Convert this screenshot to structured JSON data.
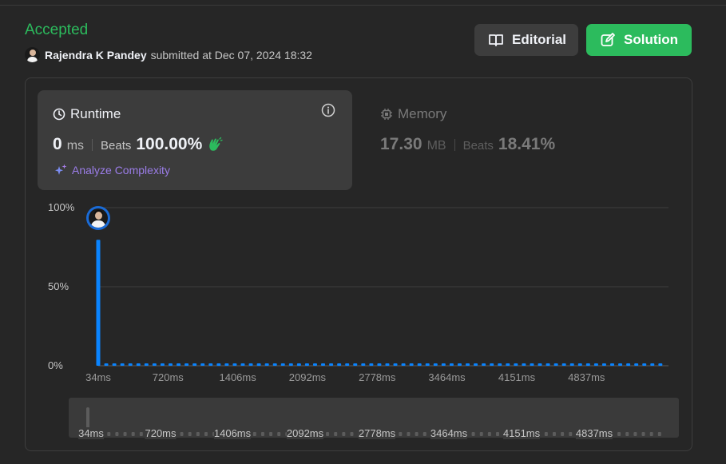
{
  "submission": {
    "status": "Accepted",
    "author": "Rajendra K Pandey",
    "submitted_text": "submitted at Dec 07, 2024 18:32"
  },
  "buttons": {
    "editorial": "Editorial",
    "solution": "Solution"
  },
  "runtime": {
    "title": "Runtime",
    "value": "0",
    "unit": "ms",
    "beats_label": "Beats",
    "beats_value": "100.00%",
    "analyze": "Analyze Complexity"
  },
  "memory": {
    "title": "Memory",
    "value": "17.30",
    "unit": "MB",
    "beats_label": "Beats",
    "beats_value": "18.41%"
  },
  "colors": {
    "accepted": "#2cbb5d",
    "bar": "#0a84ff",
    "analyze": "#9b7de8"
  },
  "chart_data": {
    "type": "bar",
    "ylabel": "",
    "xlabel": "",
    "yticks": [
      "100%",
      "50%",
      "0%"
    ],
    "ylim": [
      0,
      100
    ],
    "xticks": [
      "34ms",
      "720ms",
      "1406ms",
      "2092ms",
      "2778ms",
      "3464ms",
      "4151ms",
      "4837ms"
    ],
    "xlim": [
      34,
      5581
    ],
    "bin_width_ms": 79,
    "highlight_bin": 0,
    "series": [
      {
        "values": [
          79.7,
          1.5,
          1.5,
          1.5,
          1.5,
          1.5,
          1.5,
          1.5,
          1.5,
          1.5,
          1.5,
          1.5,
          1.5,
          1.5,
          1.5,
          1.5,
          1.5,
          1.5,
          1.5,
          1.5,
          1.5,
          1.5,
          1.5,
          1.5,
          1.5,
          1.5,
          1.5,
          1.5,
          1.5,
          1.5,
          1.5,
          1.5,
          1.5,
          1.5,
          1.5,
          1.5,
          1.5,
          1.5,
          1.5,
          1.5,
          1.5,
          1.5,
          1.5,
          1.5,
          1.5,
          1.5,
          1.5,
          1.5,
          1.5,
          1.5,
          1.5,
          1.5,
          1.5,
          1.5,
          1.5,
          1.5,
          1.5,
          1.5,
          1.5,
          1.5,
          1.5,
          1.5,
          1.5,
          1.5,
          1.5,
          1.5,
          1.5,
          1.5,
          1.5,
          1.5,
          1.5
        ]
      }
    ]
  }
}
